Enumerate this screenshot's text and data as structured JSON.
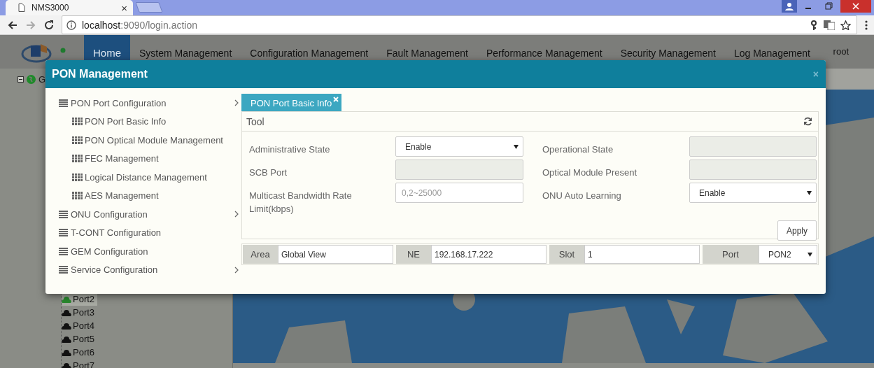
{
  "browser": {
    "tab": {
      "title": "NMS3000",
      "close": "×"
    },
    "address": {
      "host": "localhost",
      "path": ":9090/login.action"
    }
  },
  "app": {
    "nav": [
      {
        "label": "Home",
        "selected": true
      },
      {
        "label": "System Management",
        "selected": false
      },
      {
        "label": "Configuration Management",
        "selected": false
      },
      {
        "label": "Fault Management",
        "selected": false
      },
      {
        "label": "Performance Management",
        "selected": false
      },
      {
        "label": "Security Management",
        "selected": false
      },
      {
        "label": "Log Management",
        "selected": false
      }
    ],
    "user": "root",
    "tree": {
      "root": {
        "label": "G",
        "expanded": true
      },
      "ports": [
        {
          "label": "Port2",
          "selected": true
        },
        {
          "label": "Port3",
          "selected": false
        },
        {
          "label": "Port4",
          "selected": false
        },
        {
          "label": "Port5",
          "selected": false
        },
        {
          "label": "Port6",
          "selected": false
        },
        {
          "label": "Port7",
          "selected": false
        }
      ]
    }
  },
  "dialog": {
    "title": "PON Management",
    "close": "×",
    "menu": [
      {
        "label": "PON Port Configuration",
        "has_submenu": true,
        "children": [
          {
            "label": "PON Port Basic Info"
          },
          {
            "label": "PON Optical Module Management"
          },
          {
            "label": "FEC Management"
          },
          {
            "label": "Logical Distance Management"
          },
          {
            "label": "AES Management"
          }
        ]
      },
      {
        "label": "ONU Configuration",
        "has_submenu": true
      },
      {
        "label": "T-CONT Configuration",
        "has_submenu": false
      },
      {
        "label": "GEM Configuration",
        "has_submenu": false
      },
      {
        "label": "Service Configuration",
        "has_submenu": true
      }
    ],
    "tabs": [
      {
        "label": "PON Port Basic Info",
        "selected": true,
        "closable": true
      }
    ],
    "tool": "Tool",
    "fields": [
      {
        "label": "Administrative State",
        "kind": "select",
        "value": "Enable"
      },
      {
        "label": "Operational State",
        "kind": "readonly"
      },
      {
        "label": "SCB Port",
        "kind": "readonly"
      },
      {
        "label": "Optical Module Present",
        "kind": "readonly"
      },
      {
        "label": "Multicast Bandwidth Rate Limit(kbps)",
        "kind": "text",
        "placeholder": "0,2~25000"
      },
      {
        "label": "ONU Auto Learning",
        "kind": "select",
        "value": "Enable"
      }
    ],
    "apply": "Apply",
    "filters": [
      {
        "label": "Area",
        "kind": "text",
        "value": "Global View"
      },
      {
        "label": "NE",
        "kind": "text",
        "value": "192.168.17.222"
      },
      {
        "label": "Slot",
        "kind": "text",
        "value": "1"
      },
      {
        "label": "Port",
        "kind": "select",
        "value": "PON2"
      }
    ]
  }
}
